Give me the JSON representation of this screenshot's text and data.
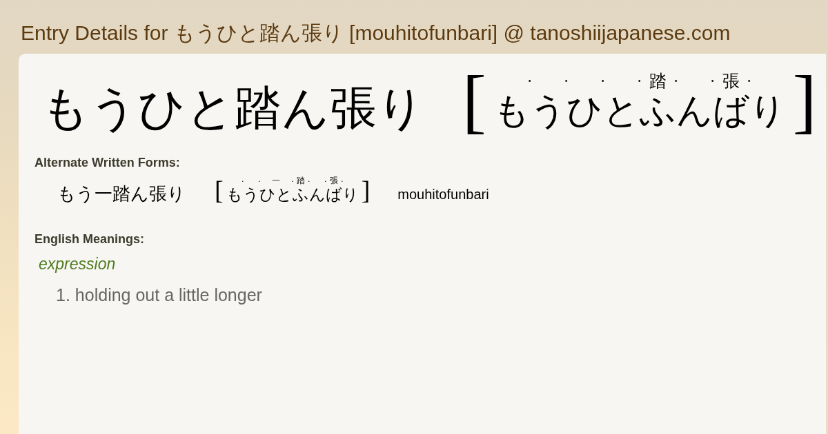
{
  "header": {
    "title": "Entry Details for もうひと踏ん張り [mouhitofunbari] @ tanoshiijapanese.com"
  },
  "entry": {
    "headword": "もうひと踏ん張り",
    "reading": {
      "open": "[",
      "close": "]",
      "segments": [
        {
          "kana": "も",
          "separator": "·"
        },
        {
          "kana": "う",
          "separator": "·"
        },
        {
          "kana": "ひ",
          "separator": "·"
        },
        {
          "kana": "と",
          "separator": "·"
        },
        {
          "kana": "ふ",
          "ruby": "踏",
          "separator": "·"
        },
        {
          "kana": "ん",
          "separator": "·"
        },
        {
          "kana": "ば",
          "ruby": "張",
          "separator": "·"
        },
        {
          "kana": "り"
        }
      ]
    }
  },
  "alternate_forms": {
    "heading": "Alternate Written Forms:",
    "forms": [
      {
        "written": "もう一踏ん張り",
        "reading": {
          "open": "[",
          "close": "]",
          "segments": [
            {
              "kana": "も",
              "separator": "·"
            },
            {
              "kana": "う",
              "separator": "·"
            },
            {
              "kana": "ひと",
              "ruby": "一",
              "separator": "·"
            },
            {
              "kana": "ふ",
              "ruby": "踏",
              "separator": "·"
            },
            {
              "kana": "ん",
              "separator": "·"
            },
            {
              "kana": "ば",
              "ruby": "張",
              "separator": "·"
            },
            {
              "kana": "り"
            }
          ]
        },
        "romaji": "mouhitofunbari"
      }
    ]
  },
  "meanings": {
    "heading": "English Meanings:",
    "groups": [
      {
        "part_of_speech": "expression",
        "senses": [
          {
            "number": "1.",
            "text": "holding out a little longer"
          }
        ]
      }
    ]
  }
}
